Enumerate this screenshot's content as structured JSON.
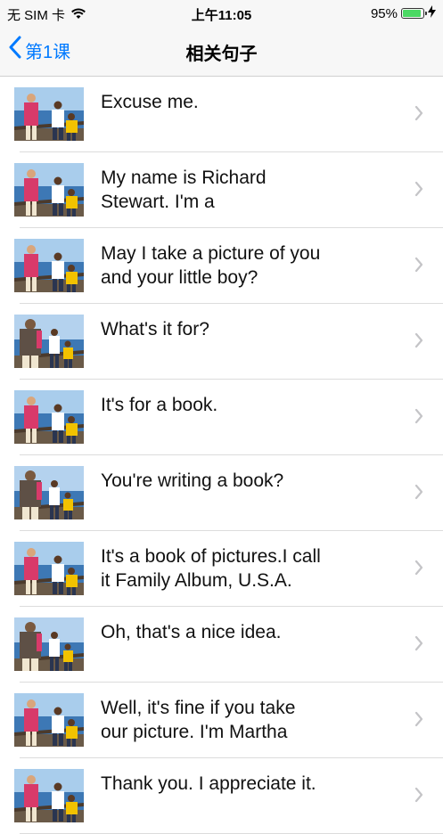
{
  "status_bar": {
    "carrier": "无 SIM 卡",
    "time": "上午11:05",
    "battery_percent_label": "95%",
    "battery_level": 0.95
  },
  "nav": {
    "back_label": "第1课",
    "title": "相关句子"
  },
  "sentences": [
    {
      "text": "Excuse me.",
      "thumb": "man-woman"
    },
    {
      "text": "My name is Richard Stewart. I'm a photographer.",
      "thumb": "man-woman"
    },
    {
      "text": "May I take a picture of you and your little boy?",
      "thumb": "man-woman"
    },
    {
      "text": "What's it for?",
      "thumb": "back-view"
    },
    {
      "text": "It's for a book.",
      "thumb": "man-woman"
    },
    {
      "text": "You're writing a book?",
      "thumb": "back-view"
    },
    {
      "text": "It's a book of pictures.I call it Family Album, U.S.A.",
      "thumb": "man-woman"
    },
    {
      "text": "Oh, that's a nice idea.",
      "thumb": "back-view"
    },
    {
      "text": "Well, it's fine if you take our picture. I'm Martha",
      "thumb": "man-woman"
    },
    {
      "text": "Thank you. I appreciate it.",
      "thumb": "man-woman"
    }
  ],
  "colors": {
    "accent": "#007aff",
    "battery_fill": "#4cd964",
    "separator": "#dcdcdc"
  }
}
